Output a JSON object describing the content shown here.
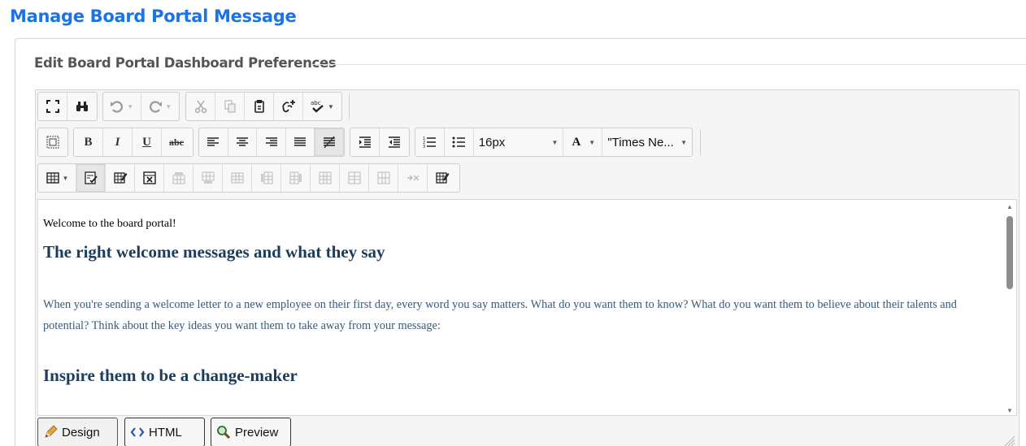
{
  "page": {
    "title": "Manage Board Portal Message"
  },
  "section": {
    "legend": "Edit Board Portal Dashboard Preferences"
  },
  "toolbar": {
    "font_size": "16px",
    "font_name": "\"Times Ne...",
    "bold_label": "B",
    "italic_label": "I",
    "underline_label": "U",
    "strike_label": "abc",
    "font_color_label": "A"
  },
  "content": {
    "greeting": "Welcome to the board portal!",
    "heading1": "The right welcome messages and what they say",
    "paragraph": "When you're sending a welcome letter to a new employee on their first day, every word you say matters. What do you want them to know? What do you want them to believe about their talents and potential? Think about the key ideas you want them to take away from your message:",
    "heading2": "Inspire them to be a change-maker"
  },
  "modes": {
    "design": "Design",
    "html": "HTML",
    "preview": "Preview"
  },
  "colors": {
    "title": "#1a73e8",
    "heading": "#1c3c5c",
    "body_text": "#3b5a78"
  }
}
